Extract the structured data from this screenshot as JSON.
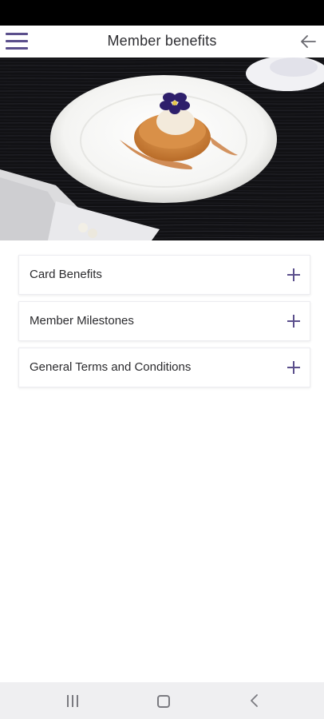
{
  "header": {
    "title": "Member benefits",
    "menu_icon": "hamburger-menu-icon",
    "back_icon": "arrow-left-icon"
  },
  "hero": {
    "description_icon": "dessert-plate-photo"
  },
  "accordion": {
    "items": [
      {
        "label": "Card Benefits",
        "icon": "plus-icon"
      },
      {
        "label": "Member Milestones",
        "icon": "plus-icon"
      },
      {
        "label": "General Terms and Conditions",
        "icon": "plus-icon"
      }
    ]
  },
  "system_nav": {
    "recent_icon": "recent-apps-icon",
    "home_icon": "home-icon",
    "back_icon": "back-chevron-icon"
  },
  "colors": {
    "accent": "#5b4f8c",
    "status_bar": "#000000",
    "nav_bar": "#efeff1"
  }
}
